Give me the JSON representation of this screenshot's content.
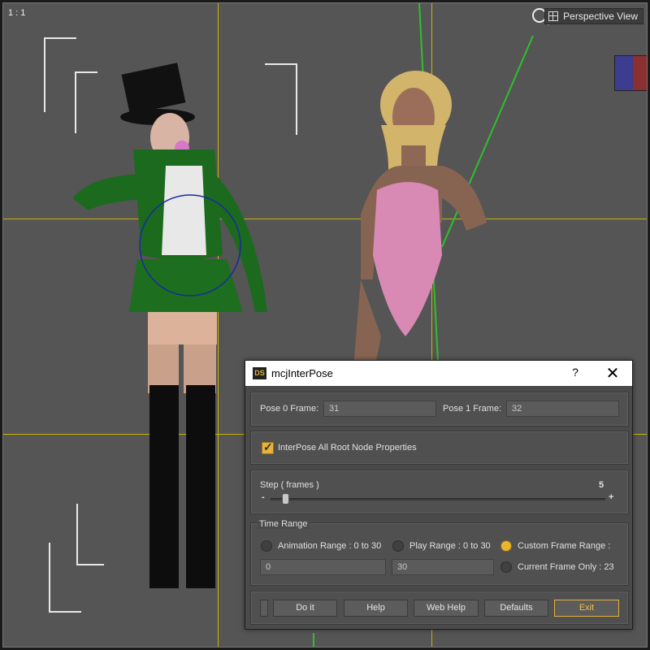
{
  "viewport": {
    "camera_ratio": "1 : 1",
    "view_label": "Perspective View"
  },
  "dialog": {
    "title": "mcjInterPose",
    "help_label": "?",
    "close_label": "✕",
    "pose0_label": "Pose 0 Frame:",
    "pose0_value": "31",
    "pose1_label": "Pose 1 Frame:",
    "pose1_value": "32",
    "checkbox_label": "InterPose All Root Node Properties",
    "checkbox_checked": true,
    "step_label": "Step ( frames )",
    "step_value": "5",
    "step_min_glyph": "-",
    "step_max_glyph": "+",
    "time_range_label": "Time Range",
    "radio_animation": "Animation Range : 0 to 30",
    "radio_play": "Play Range : 0 to 30",
    "radio_custom": "Custom Frame Range :",
    "radio_current": "Current Frame Only : 23",
    "selected_radio": "custom",
    "custom_start": "0",
    "custom_end": "30",
    "buttons": {
      "do_it": "Do it",
      "help": "Help",
      "web_help": "Web Help",
      "defaults": "Defaults",
      "exit": "Exit"
    }
  },
  "colors": {
    "accent": "#e9b630",
    "viewport_bg": "#555555",
    "guide": "#c8b400"
  }
}
